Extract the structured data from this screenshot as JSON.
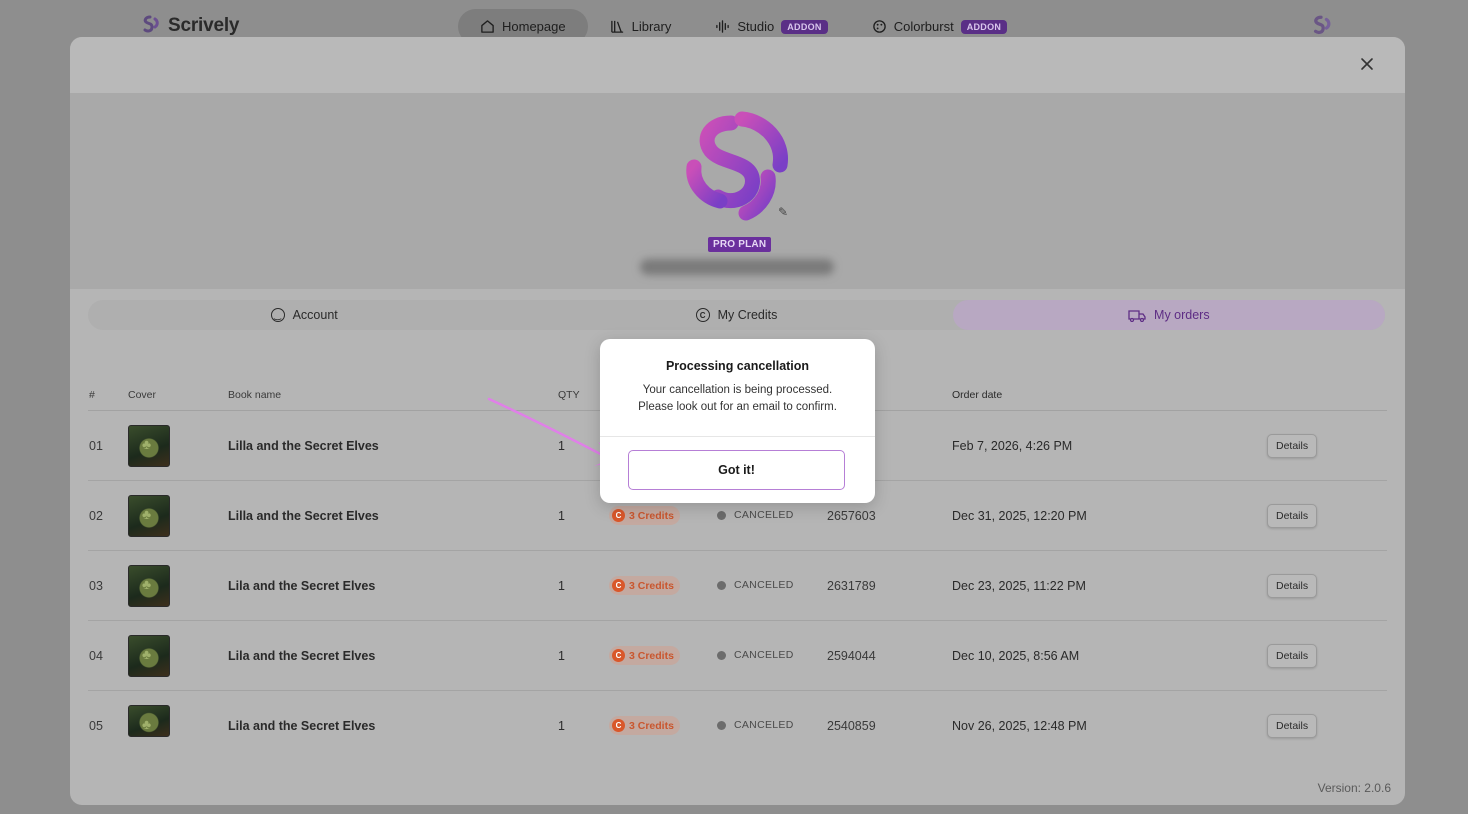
{
  "app": {
    "brand": "Scrively",
    "nav": [
      {
        "label": "Homepage",
        "icon": "home-icon",
        "active": true
      },
      {
        "label": "Library",
        "icon": "library-icon"
      },
      {
        "label": "Studio",
        "icon": "waveform-icon",
        "badge": "ADDON"
      },
      {
        "label": "Colorburst",
        "icon": "palette-icon",
        "badge": "ADDON"
      }
    ]
  },
  "profile": {
    "plan": "PRO PLAN"
  },
  "tabs": [
    {
      "label": "Account",
      "icon": "smile-icon"
    },
    {
      "label": "My Credits",
      "icon": "credits-icon"
    },
    {
      "label": "My orders",
      "icon": "truck-icon",
      "active": true
    }
  ],
  "table": {
    "headers": {
      "num": "#",
      "cover": "Cover",
      "name": "Book name",
      "qty": "QTY",
      "date": "Order date"
    },
    "rows": [
      {
        "num": "01",
        "name": "Lilla and the Secret Elves",
        "qty": "1",
        "credits": "",
        "status": "",
        "id": "",
        "date": "Feb 7, 2026, 4:26 PM",
        "action": "Details"
      },
      {
        "num": "02",
        "name": "Lilla and the Secret Elves",
        "qty": "1",
        "credits": "3 Credits",
        "status": "CANCELED",
        "id": "2657603",
        "date": "Dec 31, 2025, 12:20 PM",
        "action": "Details"
      },
      {
        "num": "03",
        "name": "Lila and the Secret Elves",
        "qty": "1",
        "credits": "3 Credits",
        "status": "CANCELED",
        "id": "2631789",
        "date": "Dec 23, 2025, 11:22 PM",
        "action": "Details"
      },
      {
        "num": "04",
        "name": "Lila and the Secret Elves",
        "qty": "1",
        "credits": "3 Credits",
        "status": "CANCELED",
        "id": "2594044",
        "date": "Dec 10, 2025, 8:56 AM",
        "action": "Details"
      },
      {
        "num": "05",
        "name": "Lila and the Secret Elves",
        "qty": "1",
        "credits": "3 Credits",
        "status": "CANCELED",
        "id": "2540859",
        "date": "Nov 26, 2025, 12:48 PM",
        "action": "Details"
      }
    ]
  },
  "version": "Version: 2.0.6",
  "dialog": {
    "title": "Processing cancellation",
    "message_line1": "Your cancellation is being processed.",
    "message_line2": "Please look out for an email to confirm.",
    "button": "Got it!"
  },
  "colors": {
    "brand_purple": "#6a2f9d",
    "accent_pink": "#e07fe8",
    "credits_orange": "#d9572a"
  }
}
